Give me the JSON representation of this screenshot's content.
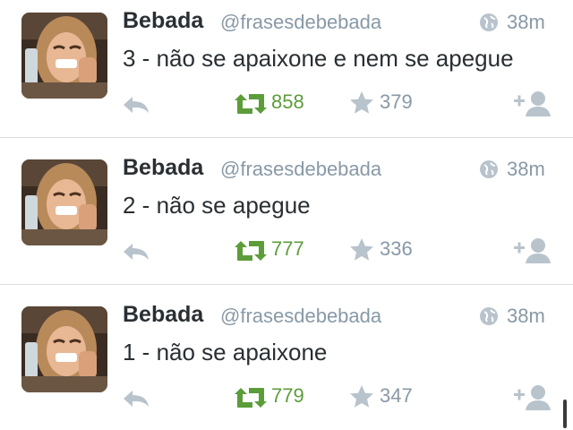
{
  "colors": {
    "name": "#292f33",
    "meta": "#8899a6",
    "retweet": "#5c9d3a",
    "icon": "#b8c3cc"
  },
  "icons": {
    "globe": "globe-icon",
    "reply": "reply-icon",
    "retweet": "retweet-icon",
    "favorite": "star-icon",
    "follow": "follow-icon"
  },
  "tweets": [
    {
      "name": "Bebada",
      "handle": "@frasesdebebada",
      "time": "38m",
      "text": "3 - não se apaixone e nem se apegue",
      "retweets": "858",
      "favorites": "379"
    },
    {
      "name": "Bebada",
      "handle": "@frasesdebebada",
      "time": "38m",
      "text": "2 - não se apegue",
      "retweets": "777",
      "favorites": "336"
    },
    {
      "name": "Bebada",
      "handle": "@frasesdebebada",
      "time": "38m",
      "text": "1 - não se apaixone",
      "retweets": "779",
      "favorites": "347"
    }
  ]
}
